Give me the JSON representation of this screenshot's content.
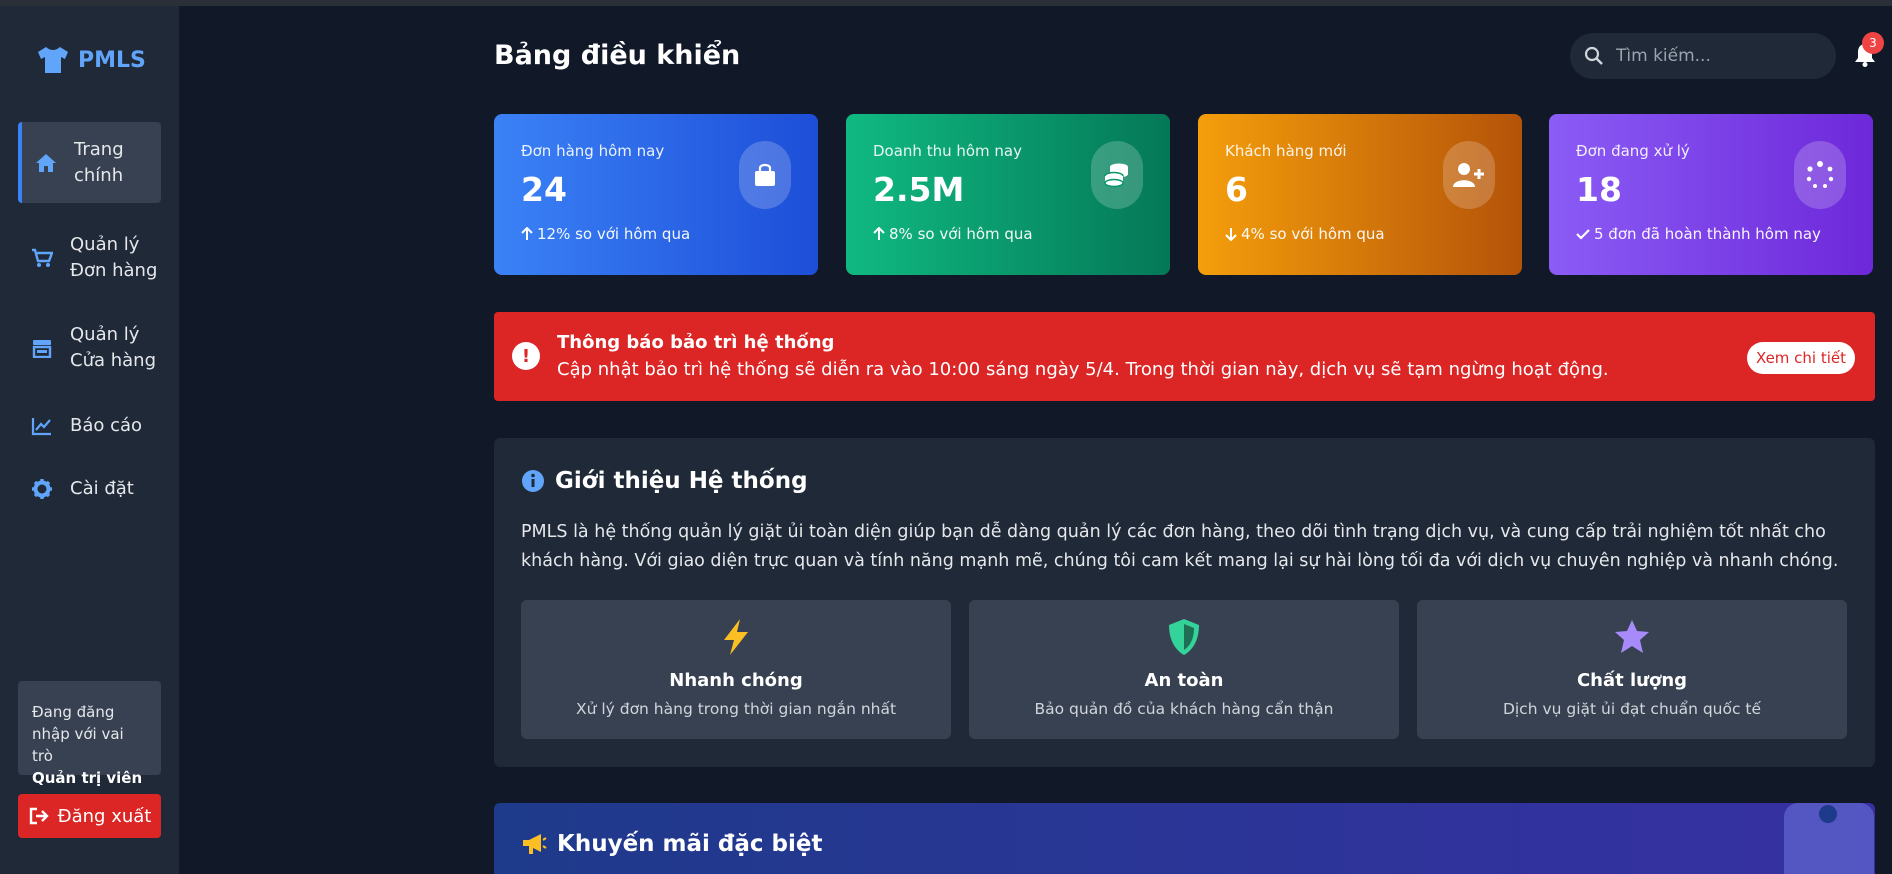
{
  "app": {
    "name": "PMLS"
  },
  "sidebar": {
    "items": [
      {
        "label_line1": "Trang",
        "label_line2": "chính",
        "icon": "home-icon",
        "active": true
      },
      {
        "label_line1": "Quản lý",
        "label_line2": "Đơn hàng",
        "icon": "cart-icon"
      },
      {
        "label_line1": "Quản lý",
        "label_line2": "Cửa hàng",
        "icon": "store-icon"
      },
      {
        "label_line1": "Báo cáo",
        "label_line2": "",
        "icon": "chart-line-icon"
      },
      {
        "label_line1": "Cài đặt",
        "label_line2": "",
        "icon": "gear-icon"
      }
    ],
    "role_line1": "Đang đăng",
    "role_line2": "nhập với vai trò",
    "role_name": "Quản trị viên",
    "logout_label": "Đăng xuất"
  },
  "header": {
    "title": "Bảng điều khiển",
    "search_placeholder": "Tìm kiếm...",
    "notification_count": "3"
  },
  "stats": [
    {
      "label": "Đơn hàng hôm nay",
      "value": "24",
      "sub": "12% so với hôm qua",
      "trend": "up",
      "icon": "shopping-bag-icon",
      "color": "#3b82f6"
    },
    {
      "label": "Doanh thu hôm nay",
      "value": "2.5M",
      "sub": "8% so với hôm qua",
      "trend": "up",
      "icon": "coins-icon",
      "color": "#10b981"
    },
    {
      "label": "Khách hàng mới",
      "value": "6",
      "sub": "4% so với hôm qua",
      "trend": "down",
      "icon": "user-plus-icon",
      "color": "#f59e0b"
    },
    {
      "label": "Đơn đang xử lý",
      "value": "18",
      "sub": "5 đơn đã hoàn thành hôm nay",
      "trend": "check",
      "icon": "spinner-icon",
      "color": "#8b5cf6"
    }
  ],
  "alert": {
    "title": "Thông báo bảo trì hệ thống",
    "text": "Cập nhật bảo trì hệ thống sẽ diễn ra vào 10:00 sáng ngày 5/4. Trong thời gian này, dịch vụ sẽ tạm ngừng hoạt động.",
    "button": "Xem chi tiết",
    "icon_glyph": "!"
  },
  "intro": {
    "title": "Giới thiệu Hệ thống",
    "text": "PMLS là hệ thống quản lý giặt ủi toàn diện giúp bạn dễ dàng quản lý các đơn hàng, theo dõi tình trạng dịch vụ, và cung cấp trải nghiệm tốt nhất cho khách hàng. Với giao diện trực quan và tính năng mạnh mẽ, chúng tôi cam kết mang lại sự hài lòng tối đa với dịch vụ chuyên nghiệp và nhanh chóng.",
    "features": [
      {
        "title": "Nhanh chóng",
        "desc": "Xử lý đơn hàng trong thời gian ngắn nhất",
        "icon": "bolt-icon",
        "color": "#fbbf24"
      },
      {
        "title": "An toàn",
        "desc": "Bảo quản đồ của khách hàng cẩn thận",
        "icon": "shield-icon",
        "color": "#34d399"
      },
      {
        "title": "Chất lượng",
        "desc": "Dịch vụ giặt ủi đạt chuẩn quốc tế",
        "icon": "star-icon",
        "color": "#a78bfa"
      }
    ]
  },
  "promo": {
    "title": "Khuyến mãi đặc biệt",
    "icon": "megaphone-icon"
  }
}
